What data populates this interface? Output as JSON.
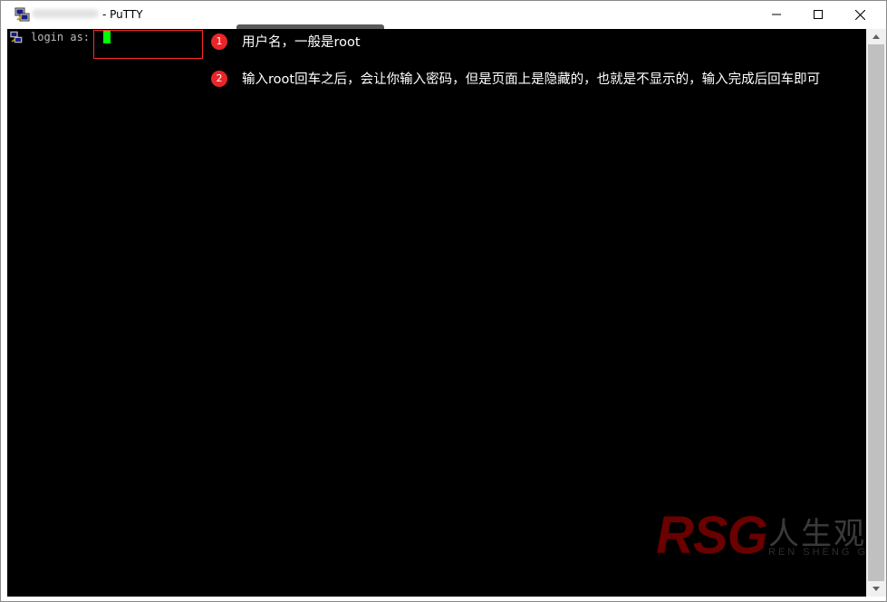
{
  "window": {
    "title": "- PuTTY",
    "controls": {
      "minimize_icon": "minimize-icon",
      "maximize_icon": "maximize-icon",
      "close_icon": "close-icon"
    }
  },
  "terminal": {
    "prompt_text": "login as:",
    "cursor_color": "#00ff00",
    "background": "#000000"
  },
  "annotations": [
    {
      "number": "1",
      "text": "用户名，一般是root"
    },
    {
      "number": "2",
      "text": "输入root回车之后，会让你输入密码，但是页面上是隐藏的，也就是不显示的，输入完成后回车即可"
    }
  ],
  "watermark": {
    "brand": "RSG",
    "chinese": "人生观",
    "subtitle": "REN SHENG GUAN"
  },
  "colors": {
    "annotation_badge": "#e8262a",
    "highlight_box": "#ff2a2a"
  }
}
